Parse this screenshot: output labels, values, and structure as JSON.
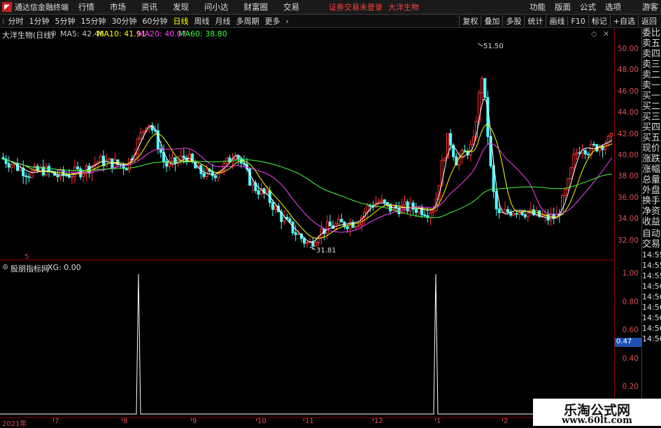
{
  "menubar": {
    "app_name": "通达信金融终端",
    "items": [
      "行情",
      "市场",
      "资讯",
      "发现",
      "问小达",
      "财富圈",
      "交易"
    ],
    "status_text": "证券交易未登录",
    "stock_name": "大洋生物",
    "right_items": [
      "功能",
      "版面",
      "公式",
      "选项"
    ],
    "guest": "游客"
  },
  "toolbar": {
    "periods": [
      "分时",
      "1分钟",
      "5分钟",
      "15分钟",
      "30分钟",
      "60分钟",
      "日线",
      "周线",
      "月线",
      "多周期",
      "更多"
    ],
    "active": "日线",
    "right_buttons": [
      "复权",
      "叠加",
      "多股",
      "统计",
      "画线",
      "F10",
      "标记",
      "+自选",
      "返回"
    ]
  },
  "main_chart": {
    "title": "大洋生物(日线)",
    "ma": [
      {
        "label": "MA5: 42.46",
        "color": "#ffffff"
      },
      {
        "label": "MA10: 41.91",
        "color": "#ffff00"
      },
      {
        "label": "MA20: 40.07",
        "color": "#ff40ff"
      },
      {
        "label": "MA60: 38.80",
        "color": "#40ff40"
      }
    ],
    "y_ticks": [
      "50.00",
      "48.00",
      "46.00",
      "44.00",
      "42.00",
      "40.00",
      "38.00",
      "36.00",
      "34.00",
      "32.00"
    ],
    "high_label": "51.50",
    "low_label": "31.81",
    "marker": "5"
  },
  "sub_chart": {
    "title": "股朋指标网",
    "value_label": "XG: 0.00",
    "y_ticks": [
      "1.00",
      "0.80",
      "0.60",
      "0.40",
      "0.20"
    ],
    "cursor_value": "0.47"
  },
  "sidebar": {
    "items": [
      "委比",
      "卖五",
      "卖四",
      "卖三",
      "卖二",
      "卖一",
      "买一",
      "买二",
      "买三",
      "买四",
      "买五",
      "现价",
      "涨跌",
      "涨幅",
      "总量",
      "外盘",
      "换手",
      "净资",
      "收益",
      "自动",
      "交易",
      "14:55",
      "14:55",
      "14:55",
      "14:56",
      "14:56",
      "14:56",
      "14:56",
      "14:56",
      "14:56"
    ]
  },
  "x_labels": [
    "2021年",
    "7",
    "8",
    "9",
    "10",
    "11",
    "12",
    "1",
    "2"
  ],
  "watermark": {
    "title": "乐淘公式网",
    "url": "www.60lt.com"
  },
  "colors": {
    "up": "#ff3232",
    "down": "#54ffff",
    "axis": "#e05050"
  },
  "chart_data": {
    "type": "candlestick",
    "title": "大洋生物(日线)",
    "ylim": [
      31,
      52
    ],
    "annotations": {
      "high": 51.5,
      "low": 31.81
    },
    "ohlc": [],
    "indicator": {
      "name": "XG",
      "ylim": [
        0,
        1
      ],
      "signals_at_month": [
        "8",
        "1"
      ]
    }
  }
}
